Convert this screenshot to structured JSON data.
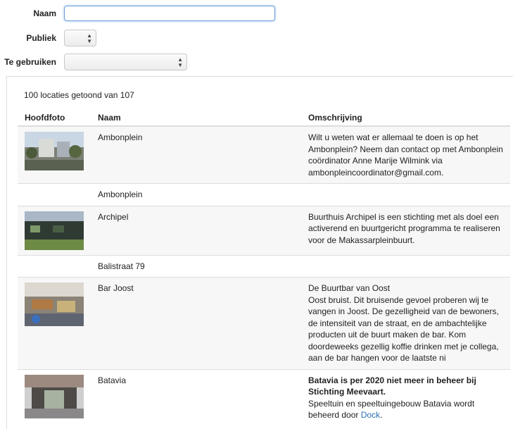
{
  "filters": {
    "naam_label": "Naam",
    "naam_value": "",
    "publiek_label": "Publiek",
    "publiek_value": "",
    "gebruiken_label": "Te gebruiken",
    "gebruiken_value": ""
  },
  "list": {
    "count_text": "100 locaties getoond van 107",
    "headers": {
      "photo": "Hoofdfoto",
      "name": "Naam",
      "desc": "Omschrijving"
    },
    "rows": [
      {
        "name": "Ambonplein",
        "desc": "Wilt u weten wat er allemaal te doen is op het Ambonplein? Neem dan contact op met Ambonplein coördinator Anne Marije Wilmink via ambonpleincoordinator@gmail.com."
      },
      {
        "name": "Ambonplein",
        "desc": ""
      },
      {
        "name": "Archipel",
        "desc": "Buurthuis Archipel is een stichting met als doel een activerend en buurtgericht programma te realiseren voor de Makassarpleinbuurt."
      },
      {
        "name": "Balistraat 79",
        "desc": ""
      },
      {
        "name": "Bar Joost",
        "desc_title": "De Buurtbar van Oost",
        "desc": "Oost bruist. Dit bruisende gevoel proberen wij te vangen in Joost. De gezelligheid van de bewoners, de intensiteit van de straat, en de ambachtelijke producten uit de buurt maken de bar. Kom doordeweeks gezellig koffie drinken met je collega, aan de bar hangen voor de laatste ni"
      },
      {
        "name": "Batavia",
        "desc_bold": "Batavia is per 2020 niet meer in beheer bij Stichting Meevaart.",
        "desc": "Speeltuin en speeltuingebouw Batavia wordt beheerd door ",
        "desc_link": "Dock",
        "desc_after": "."
      }
    ]
  },
  "icons": {
    "select_arrows": "up-down-arrows-icon"
  }
}
